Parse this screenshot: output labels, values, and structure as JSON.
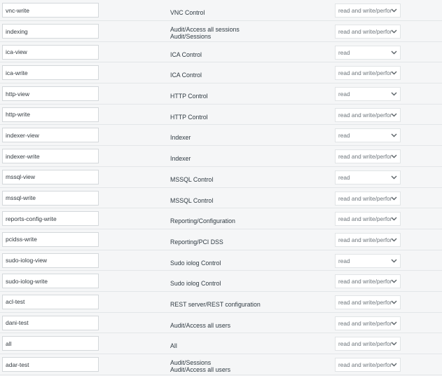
{
  "rows": [
    {
      "name": "vnc-write",
      "objects": [
        "VNC Control"
      ],
      "permission": "read and write/perform"
    },
    {
      "name": "indexing",
      "objects": [
        "Audit/Access all sessions",
        "Audit/Sessions"
      ],
      "permission": "read and write/perform"
    },
    {
      "name": "ica-view",
      "objects": [
        "ICA Control"
      ],
      "permission": "read"
    },
    {
      "name": "ica-write",
      "objects": [
        "ICA Control"
      ],
      "permission": "read and write/perform"
    },
    {
      "name": "http-view",
      "objects": [
        "HTTP Control"
      ],
      "permission": "read"
    },
    {
      "name": "http-write",
      "objects": [
        "HTTP Control"
      ],
      "permission": "read and write/perform"
    },
    {
      "name": "indexer-view",
      "objects": [
        "Indexer"
      ],
      "permission": "read"
    },
    {
      "name": "indexer-write",
      "objects": [
        "Indexer"
      ],
      "permission": "read and write/perform"
    },
    {
      "name": "mssql-view",
      "objects": [
        "MSSQL Control"
      ],
      "permission": "read"
    },
    {
      "name": "mssql-write",
      "objects": [
        "MSSQL Control"
      ],
      "permission": "read and write/perform"
    },
    {
      "name": "reports-config-write",
      "objects": [
        "Reporting/Configuration"
      ],
      "permission": "read and write/perform"
    },
    {
      "name": "pcidss-write",
      "objects": [
        "Reporting/PCI DSS"
      ],
      "permission": "read and write/perform"
    },
    {
      "name": "sudo-iolog-view",
      "objects": [
        "Sudo iolog Control"
      ],
      "permission": "read"
    },
    {
      "name": "sudo-iolog-write",
      "objects": [
        "Sudo iolog Control"
      ],
      "permission": "read and write/perform"
    },
    {
      "name": "acl-test",
      "objects": [
        "REST server/REST configuration"
      ],
      "permission": "read and write/perform"
    },
    {
      "name": "dani-test",
      "objects": [
        "Audit/Access all users"
      ],
      "permission": "read and write/perform"
    },
    {
      "name": "all",
      "objects": [
        "All"
      ],
      "permission": "read and write/perform"
    },
    {
      "name": "adar-test",
      "objects": [
        "Audit/Sessions",
        "Audit/Access all users"
      ],
      "permission": "read and write/perform"
    }
  ],
  "icons": {
    "dropdown": "chevron-down-icon"
  },
  "colors": {
    "background": "#f5f6f7",
    "text": "#2f3a42",
    "border": "#e3e6e8"
  }
}
